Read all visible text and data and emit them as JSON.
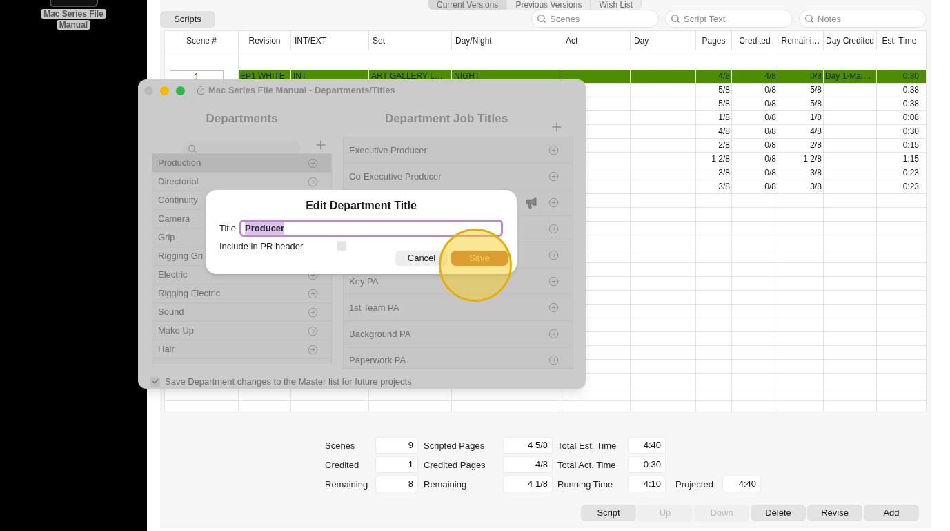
{
  "desktop_icon": {
    "label": "Mac Series File Manual"
  },
  "version_tabs": [
    {
      "label": "Current Versions",
      "selected": true
    },
    {
      "label": "Previous Versions",
      "selected": false
    },
    {
      "label": "Wish List",
      "selected": false
    }
  ],
  "scripts_button": "Scripts",
  "searches": [
    {
      "placeholder": "Scenes"
    },
    {
      "placeholder": "Script Text"
    },
    {
      "placeholder": "Notes"
    }
  ],
  "table": {
    "columns": [
      "Scene #",
      "Revision",
      "INT/EXT",
      "Set",
      "Day/Night",
      "Act",
      "Day",
      "Pages",
      "Credited",
      "Remaini…",
      "Day Credited",
      "Est. Time"
    ],
    "rows": [
      {
        "selected": true,
        "scene": "1",
        "revision": "EP1 WHITE",
        "int_ext": "INT",
        "set": "ART GALLERY L…",
        "day_night": "NIGHT",
        "pages": "4/8",
        "credited": "4/8",
        "remaining": "0/8",
        "day_credited": "Day 1-Mai…",
        "est_time": "0:30"
      },
      {
        "selected": false,
        "pages": "5/8",
        "credited": "0/8",
        "remaining": "5/8",
        "est_time": "0:38"
      },
      {
        "selected": false,
        "pages": "5/8",
        "credited": "0/8",
        "remaining": "5/8",
        "est_time": "0:38"
      },
      {
        "selected": false,
        "pages": "1/8",
        "credited": "0/8",
        "remaining": "1/8",
        "est_time": "0:08"
      },
      {
        "selected": false,
        "pages": "4/8",
        "credited": "0/8",
        "remaining": "4/8",
        "est_time": "0:30"
      },
      {
        "selected": false,
        "pages": "2/8",
        "credited": "0/8",
        "remaining": "2/8",
        "est_time": "0:15"
      },
      {
        "selected": false,
        "pages": "1 2/8",
        "credited": "0/8",
        "remaining": "1 2/8",
        "est_time": "1:15"
      },
      {
        "selected": false,
        "pages": "3/8",
        "credited": "0/8",
        "remaining": "3/8",
        "est_time": "0:23"
      },
      {
        "selected": false,
        "pages": "3/8",
        "credited": "0/8",
        "remaining": "3/8",
        "est_time": "0:23"
      }
    ]
  },
  "summary": [
    [
      {
        "label": "Scenes",
        "value": "9"
      },
      {
        "label": "Scripted Pages",
        "value": "4 5/8"
      },
      {
        "label": "Total Est. Time",
        "value": "4:40"
      }
    ],
    [
      {
        "label": "Credited",
        "value": "1"
      },
      {
        "label": "Credited Pages",
        "value": "4/8"
      },
      {
        "label": "Total Act. Time",
        "value": "0:30"
      }
    ],
    [
      {
        "label": "Remaining",
        "value": "8"
      },
      {
        "label": "Remaining",
        "value": "4 1/8"
      },
      {
        "label": "Running Time",
        "value": "4:10"
      },
      {
        "label": "Projected",
        "value": "4:40"
      }
    ]
  ],
  "buttons": [
    {
      "label": "Script",
      "disabled": false
    },
    {
      "label": "Up",
      "disabled": true
    },
    {
      "label": "Down",
      "disabled": true
    },
    {
      "label": "Delete",
      "disabled": false
    },
    {
      "label": "Revise",
      "disabled": false
    },
    {
      "label": "Add",
      "disabled": false
    }
  ],
  "departments_window": {
    "title": "Mac Series File Manual - Departments/Titles",
    "departments_heading": "Departments",
    "departments": [
      {
        "name": "Production",
        "selected": true
      },
      {
        "name": "Directorial",
        "selected": false
      },
      {
        "name": "Continuity",
        "selected": false
      },
      {
        "name": "Camera",
        "selected": false
      },
      {
        "name": "Grip",
        "selected": false
      },
      {
        "name": "Rigging Gri",
        "selected": false
      },
      {
        "name": "Electric",
        "selected": false
      },
      {
        "name": "Rigging Electric",
        "selected": false
      },
      {
        "name": "Sound",
        "selected": false
      },
      {
        "name": "Make Up",
        "selected": false
      },
      {
        "name": "Hair",
        "selected": false
      }
    ],
    "job_titles_heading": "Department Job Titles",
    "job_titles": [
      {
        "kind": "title",
        "title": "Executive Producer"
      },
      {
        "kind": "title",
        "title": "Co-Executive Producer"
      },
      {
        "kind": "covered_megaphone"
      },
      {
        "kind": "covered"
      },
      {
        "kind": "covered"
      },
      {
        "kind": "title",
        "title": "Key PA"
      },
      {
        "kind": "title",
        "title": "1st Team PA"
      },
      {
        "kind": "title",
        "title": "Background PA"
      },
      {
        "kind": "title",
        "title": "Paperwork PA"
      }
    ],
    "save_to_master": {
      "label": "Save Department changes to the Master list for future projects",
      "checked": true
    }
  },
  "edit_sheet": {
    "heading": "Edit Department Title",
    "title_label": "Title",
    "title_value": "Producer",
    "title_value_selected": true,
    "include_label": "Include in PR header",
    "include_checked": false,
    "cancel": "Cancel",
    "save": "Save"
  }
}
